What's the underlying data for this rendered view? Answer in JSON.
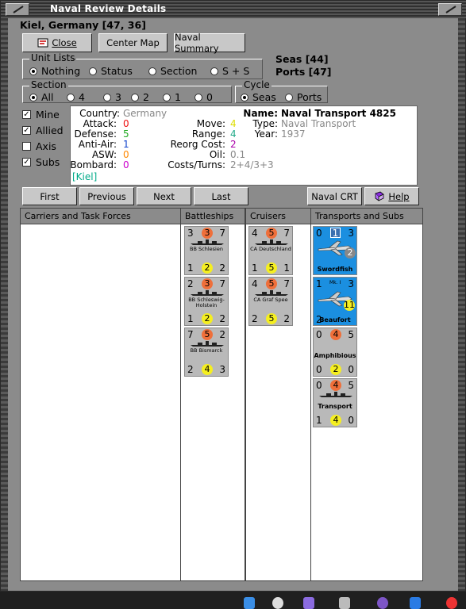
{
  "window": {
    "title": "Naval Review Details"
  },
  "location": "Kiel, Germany [47, 36]",
  "toolbar": {
    "close": "Close",
    "center_map": "Center Map",
    "naval_summary": "Naval Summary"
  },
  "unit_lists": {
    "label": "Unit Lists",
    "options": [
      "Nothing",
      "Status",
      "Section",
      "S + S"
    ],
    "selected": "Nothing"
  },
  "counts": {
    "seas": "Seas [44]",
    "ports": "Ports [47]"
  },
  "section": {
    "label": "Section",
    "options": [
      "All",
      "4",
      "3",
      "2",
      "1",
      "0"
    ],
    "selected": "All"
  },
  "cycle": {
    "label": "Cycle",
    "options": [
      "Seas",
      "Ports"
    ],
    "selected": "Seas"
  },
  "filters": [
    {
      "label": "Mine",
      "checked": true
    },
    {
      "label": "Allied",
      "checked": true
    },
    {
      "label": "Axis",
      "checked": false
    },
    {
      "label": "Subs",
      "checked": true
    }
  ],
  "info": {
    "country_label": "Country:",
    "country": "Germany",
    "attack_label": "Attack:",
    "attack": "0",
    "defense_label": "Defense:",
    "defense": "5",
    "antiair_label": "Anti-Air:",
    "antiair": "1",
    "asw_label": "ASW:",
    "asw": "0",
    "bombard_label": "Bombard:",
    "bombard": "0",
    "port": "[Kiel]",
    "move_label": "Move:",
    "move": "4",
    "range_label": "Range:",
    "range": "4",
    "reorg_label": "Reorg Cost:",
    "reorg": "2",
    "oil_label": "Oil:",
    "oil": "0.1",
    "costs_label": "Costs/Turns:",
    "costs": "2+4/3+3",
    "name_label": "Name:",
    "name": "Naval Transport 4825",
    "type_label": "Type:",
    "type": "Naval Transport",
    "year_label": "Year:",
    "year": "1937"
  },
  "nav": {
    "first": "First",
    "previous": "Previous",
    "next": "Next",
    "last": "Last",
    "naval_crt": "Naval CRT",
    "help": "Help"
  },
  "columns": {
    "carriers": "Carriers and Task Forces",
    "battleships": "Battleships",
    "cruisers": "Cruisers",
    "transports": "Transports and Subs"
  },
  "battleships": [
    {
      "tl": "3",
      "tc": "3",
      "tr": "7",
      "name": "BB Schlesien",
      "bl": "1",
      "bc": "2",
      "br": "2"
    },
    {
      "tl": "2",
      "tc": "3",
      "tr": "7",
      "name": "BB Schleswig-Holstein",
      "bl": "1",
      "bc": "2",
      "br": "2"
    },
    {
      "tl": "7",
      "tc": "5",
      "tr": "2",
      "name": "BB Bismarck",
      "bl": "2",
      "bc": "4",
      "br": "3"
    }
  ],
  "cruisers": [
    {
      "tl": "4",
      "tc": "5",
      "tr": "7",
      "name": "CA Deutschland",
      "bl": "1",
      "bc": "5",
      "br": "1"
    },
    {
      "tl": "4",
      "tc": "5",
      "tr": "7",
      "name": "CA Graf Spee",
      "bl": "2",
      "bc": "5",
      "br": "2"
    }
  ],
  "transports": [
    {
      "tl": "0",
      "tc": "1",
      "tr": "3",
      "name": "Swordfish",
      "extra": "2",
      "blue": true
    },
    {
      "tl": "1",
      "tc": "Mk. I",
      "tr": "3",
      "name": "Beaufort",
      "extra": "11",
      "bl": "2",
      "blue": true
    },
    {
      "tl": "0",
      "tc": "4",
      "tr": "5",
      "name": "Amphibious",
      "bl": "0",
      "bc": "2",
      "br": "0"
    },
    {
      "tl": "0",
      "tc": "4",
      "tr": "5",
      "name": "Transport",
      "bl": "1",
      "bc": "4",
      "br": "0"
    }
  ],
  "colors": {
    "attack": "#ee1111",
    "defense": "#22aa22",
    "antiair": "#1144cc",
    "asw": "#ff8c00",
    "bombard": "#cc00cc",
    "grey": "#888888",
    "port": "#00a080"
  }
}
